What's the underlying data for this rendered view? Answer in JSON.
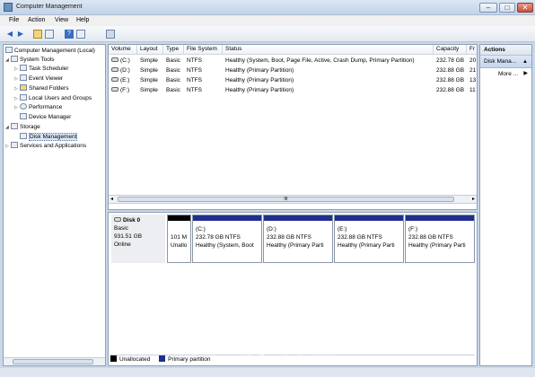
{
  "window": {
    "title": "Computer Management"
  },
  "menu": {
    "items": [
      "File",
      "Action",
      "View",
      "Help"
    ]
  },
  "toolbar": {
    "icons": [
      "back-arrow-icon",
      "forward-arrow-icon",
      "up-folder-icon",
      "show-hide-tree-icon",
      "help-icon",
      "properties-icon",
      "console-icon"
    ]
  },
  "tree": {
    "nodes": [
      {
        "label": "Computer Management (Local)",
        "icon": "computer-icon"
      },
      {
        "label": "System Tools",
        "icon": "tools-icon"
      },
      {
        "label": "Task Scheduler",
        "icon": "clock-icon"
      },
      {
        "label": "Event Viewer",
        "icon": "event-viewer-icon"
      },
      {
        "label": "Shared Folders",
        "icon": "folder-icon"
      },
      {
        "label": "Local Users and Groups",
        "icon": "users-icon"
      },
      {
        "label": "Performance",
        "icon": "performance-icon"
      },
      {
        "label": "Device Manager",
        "icon": "device-manager-icon"
      },
      {
        "label": "Storage",
        "icon": "storage-icon"
      },
      {
        "label": "Disk Management",
        "icon": "disk-icon"
      },
      {
        "label": "Services and Applications",
        "icon": "services-icon"
      }
    ]
  },
  "volumes": {
    "columns": [
      "Volume",
      "Layout",
      "Type",
      "File System",
      "Status",
      "Capacity",
      "Fr"
    ],
    "rows": [
      [
        "(C:)",
        "Simple",
        "Basic",
        "NTFS",
        "Healthy (System, Boot, Page File, Active, Crash Dump, Primary Partition)",
        "232.78 GB",
        "20"
      ],
      [
        "(D:)",
        "Simple",
        "Basic",
        "NTFS",
        "Healthy (Primary Partition)",
        "232.88 GB",
        "21"
      ],
      [
        "(E:)",
        "Simple",
        "Basic",
        "NTFS",
        "Healthy (Primary Partition)",
        "232.88 GB",
        "13"
      ],
      [
        "(F:)",
        "Simple",
        "Basic",
        "NTFS",
        "Healthy (Primary Partition)",
        "232.88 GB",
        "11"
      ]
    ]
  },
  "disk": {
    "name": "Disk 0",
    "type": "Basic",
    "size": "931.51 GB",
    "state": "Online",
    "partitions": [
      {
        "line1": "",
        "line2": "101 M",
        "line3": "Unallo",
        "kind": "unallocated"
      },
      {
        "line1": "(C:)",
        "line2": "232.78 GB NTFS",
        "line3": "Healthy (System, Boot",
        "kind": "primary"
      },
      {
        "line1": "(D:)",
        "line2": "232.88 GB NTFS",
        "line3": "Healthy (Primary Parti",
        "kind": "primary"
      },
      {
        "line1": "(E:)",
        "line2": "232.88 GB NTFS",
        "line3": "Healthy (Primary Parti",
        "kind": "primary"
      },
      {
        "line1": "(F:)",
        "line2": "232.88 GB NTFS",
        "line3": "Healthy (Primary Parti",
        "kind": "primary"
      }
    ]
  },
  "legend": {
    "unallocated": "Unallocated",
    "primary": "Primary partition",
    "unallocated_color": "#000000",
    "primary_color": "#1f2f8f"
  },
  "actions": {
    "header": "Actions",
    "section": "Disk Mana...",
    "more": "More ..."
  },
  "watermark": "BikriSohoj.com",
  "colors": {
    "accent": "#1f2f8f",
    "selection": "#dde8f6"
  }
}
